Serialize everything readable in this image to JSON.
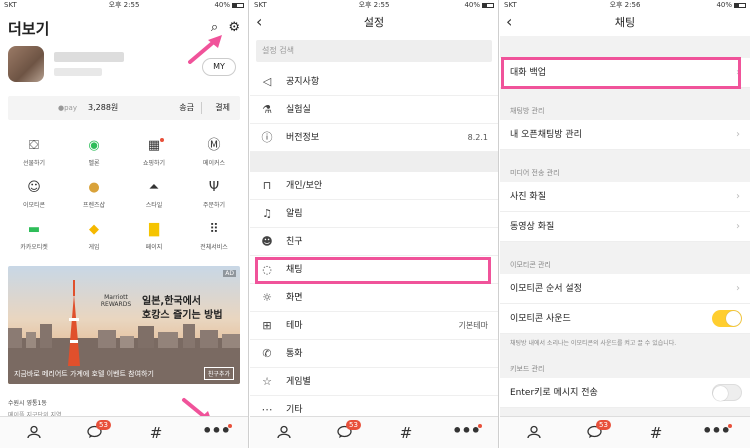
{
  "accent": "#f0539a",
  "status": {
    "carrier": "SKT",
    "time1": "오후 2:55",
    "time2": "오후 2:55",
    "time3": "오후 2:56",
    "battery": "40%"
  },
  "tabbar": {
    "badge": "53",
    "hash": "#"
  },
  "more": {
    "title": "더보기",
    "my": "MY",
    "pay": {
      "amount": "3,288원",
      "send": "송금",
      "payment": "결제"
    },
    "grid": [
      {
        "icon": "gift-icon",
        "glyph": "🎁",
        "label": "선물하기"
      },
      {
        "icon": "melon-icon",
        "glyph": "●",
        "label": "멜론"
      },
      {
        "icon": "shop-icon",
        "glyph": "▦",
        "label": "쇼핑하기"
      },
      {
        "icon": "makers-icon",
        "glyph": "Ⓜ",
        "label": "메이커스"
      },
      {
        "icon": "emoticon-icon",
        "glyph": "☺",
        "label": "이모티콘"
      },
      {
        "icon": "friends-icon",
        "glyph": "🐻",
        "label": "프렌즈샵"
      },
      {
        "icon": "style-icon",
        "glyph": "⌂",
        "label": "스타일"
      },
      {
        "icon": "order-icon",
        "glyph": "⑂",
        "label": "주문하기"
      },
      {
        "icon": "ticket-icon",
        "glyph": "▭",
        "label": "카카오티켓"
      },
      {
        "icon": "game-icon",
        "glyph": "◆",
        "label": "게임"
      },
      {
        "icon": "page-icon",
        "glyph": "▤",
        "label": "페이지"
      },
      {
        "icon": "all-services-icon",
        "glyph": "⠿",
        "label": "전체서비스"
      }
    ],
    "banner": {
      "ad": "AD",
      "brand": "Marriott REWARDS",
      "line1": "일본,한국에서",
      "line2": "호캉스 즐기는 방법",
      "caption": "지금바로 메리어트 가계에 호텔 이벤트 참여하기",
      "button": "친구추가"
    },
    "footer1": "수원시 영통1동",
    "footer2": "메이플 지구단위 지역"
  },
  "settings": {
    "title": "설정",
    "search_placeholder": "설정 검색",
    "rows": [
      {
        "icon": "notice-icon",
        "glyph": "📢",
        "label": "공지사항",
        "value": ""
      },
      {
        "icon": "labs-icon",
        "glyph": "⚗",
        "label": "실험실",
        "value": ""
      },
      {
        "icon": "info-icon",
        "glyph": "ⓘ",
        "label": "버전정보",
        "value": "8.2.1"
      },
      {
        "icon": "lock-icon",
        "glyph": "🔒",
        "label": "개인/보안",
        "value": ""
      },
      {
        "icon": "bell-icon",
        "glyph": "🔔",
        "label": "알림",
        "value": ""
      },
      {
        "icon": "person-icon",
        "glyph": "👤",
        "label": "친구",
        "value": ""
      },
      {
        "icon": "chat-bubble-icon",
        "glyph": "💬",
        "label": "채팅",
        "value": ""
      },
      {
        "icon": "brightness-icon",
        "glyph": "☼",
        "label": "화면",
        "value": ""
      },
      {
        "icon": "theme-icon",
        "glyph": "🎨",
        "label": "테마",
        "value": "기본테마"
      },
      {
        "icon": "phone-icon",
        "glyph": "📞",
        "label": "통화",
        "value": ""
      },
      {
        "icon": "star-icon",
        "glyph": "☆",
        "label": "게임별",
        "value": ""
      },
      {
        "icon": "etc-icon",
        "glyph": "⋯",
        "label": "기타",
        "value": ""
      }
    ]
  },
  "chat": {
    "title": "채팅",
    "backup": "대화 백업",
    "sec_chatroom": "채팅방 관리",
    "open_chat": "내 오픈채팅방 관리",
    "sec_media": "미디어 전송 관리",
    "photo": "사진 화질",
    "video": "동영상 화질",
    "sec_emoticon": "이모티콘 관리",
    "emoticon_order": "이모티콘 순서 설정",
    "emoticon_sound": "이모티콘 사운드",
    "emoticon_note": "채팅방 내에서 소리나는 이모티콘의 사운드를 켜고 끌 수 있습니다.",
    "sec_keyboard": "키보드 관리",
    "enter_send": "Enter키로 메시지 전송",
    "emoticon_sound_on": 1,
    "enter_send_on": 0
  }
}
